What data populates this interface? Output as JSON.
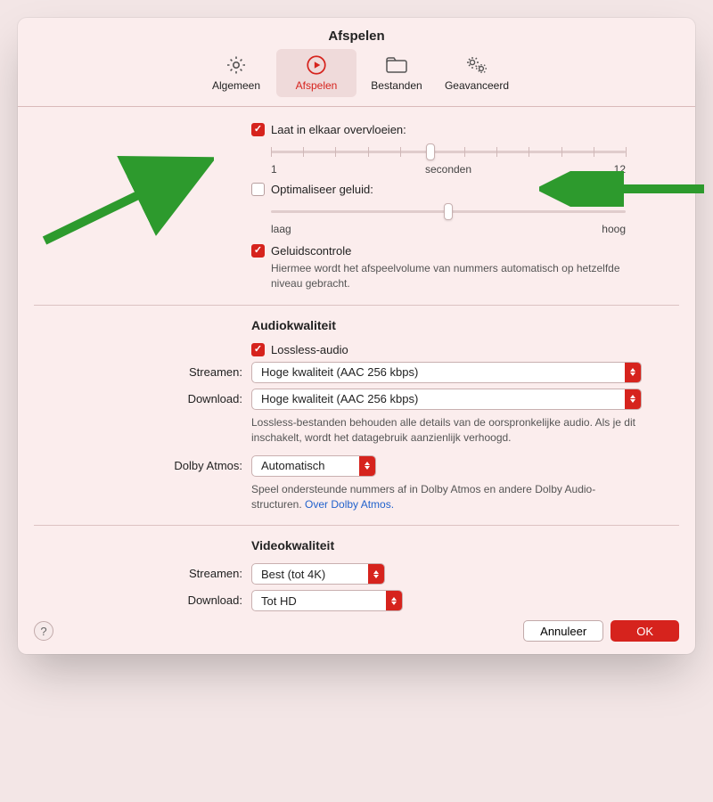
{
  "title": "Afspelen",
  "tabs": {
    "general": "Algemeen",
    "playback": "Afspelen",
    "files": "Bestanden",
    "advanced": "Geavanceerd"
  },
  "crossfade": {
    "label": "Laat in elkaar overvloeien:",
    "min": "1",
    "unit": "seconden",
    "max": "12"
  },
  "soundEnhancer": {
    "label": "Optimaliseer geluid:",
    "low": "laag",
    "high": "hoog"
  },
  "soundCheck": {
    "label": "Geluidscontrole",
    "help": "Hiermee wordt het afspeelvolume van nummers automatisch op hetzelfde niveau gebracht."
  },
  "audio": {
    "heading": "Audiokwaliteit",
    "lossless": "Lossless-audio",
    "streamLabel": "Streamen:",
    "streamValue": "Hoge kwaliteit (AAC 256 kbps)",
    "downloadLabel": "Download:",
    "downloadValue": "Hoge kwaliteit (AAC 256 kbps)",
    "help": "Lossless-bestanden behouden alle details van de oorspronkelijke audio. Als je dit inschakelt, wordt het datagebruik aanzienlijk verhoogd.",
    "atmosLabel": "Dolby Atmos:",
    "atmosValue": "Automatisch",
    "atmosHelp1": "Speel ondersteunde nummers af in Dolby Atmos en andere Dolby Audio-structuren. ",
    "atmosLink": "Over Dolby Atmos."
  },
  "video": {
    "heading": "Videokwaliteit",
    "streamLabel": "Streamen:",
    "streamValue": "Best (tot 4K)",
    "downloadLabel": "Download:",
    "downloadValue": "Tot HD"
  },
  "buttons": {
    "cancel": "Annuleer",
    "ok": "OK"
  }
}
